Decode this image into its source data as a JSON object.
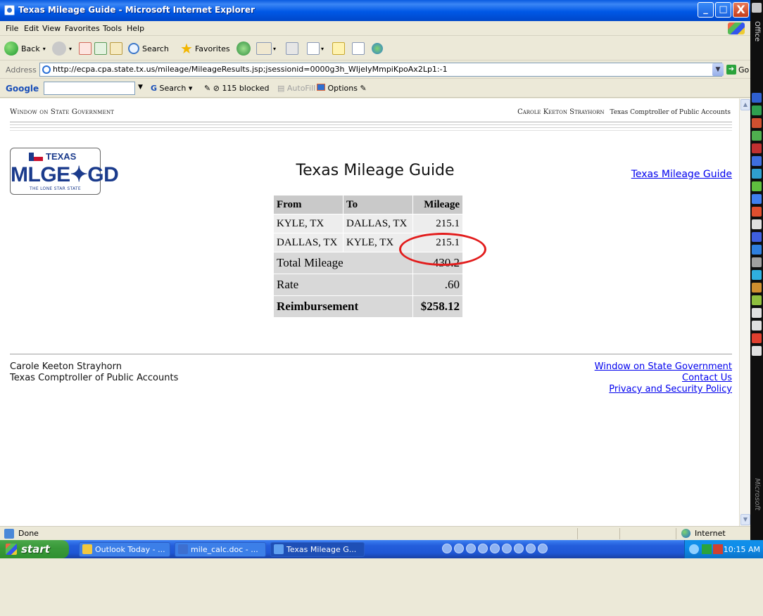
{
  "window": {
    "title": "Texas Mileage Guide - Microsoft Internet Explorer",
    "min": "_",
    "max": "□",
    "close": "X"
  },
  "menu": [
    "File",
    "Edit",
    "View",
    "Favorites",
    "Tools",
    "Help"
  ],
  "toolbar": {
    "back": "Back",
    "search": "Search",
    "favorites": "Favorites"
  },
  "address": {
    "label": "Address",
    "url": "http://ecpa.cpa.state.tx.us/mileage/MileageResults.jsp;jsessionid=0000g3h_WIjeIyMmpiKpoAx2Lp1:-1",
    "go": "Go"
  },
  "googlebar": {
    "logo": "Google",
    "search": "Search",
    "blocked": "115 blocked",
    "autofill": "AutoFill",
    "options": "Options"
  },
  "page": {
    "header_left": "Window on State Government",
    "header_right_name": "Carole Keeton Strayhorn",
    "header_right_title": "Texas Comptroller of Public Accounts",
    "plate": {
      "state": "TEXAS",
      "text": "MLGE✦GD",
      "slogan": "THE LONE STAR STATE"
    },
    "top_link": "Texas Mileage Guide",
    "title": "Texas Mileage Guide",
    "table": {
      "headers": [
        "From",
        "To",
        "Mileage"
      ],
      "rows": [
        [
          "KYLE, TX",
          "DALLAS, TX",
          "215.1"
        ],
        [
          "DALLAS, TX",
          "KYLE, TX",
          "215.1"
        ]
      ],
      "total_label": "Total Mileage",
      "total_value": "430.2",
      "rate_label": "Rate",
      "rate_value": ".60",
      "reimb_label": "Reimbursement",
      "reimb_value": "$258.12"
    },
    "footer_left": [
      "Carole Keeton Strayhorn",
      "Texas Comptroller of Public Accounts"
    ],
    "footer_links": [
      "Window on State Government",
      "Contact Us",
      "Privacy and Security Policy"
    ]
  },
  "status": {
    "text": "Done",
    "zone": "Internet"
  },
  "taskbar": {
    "start": "start",
    "tasks": [
      "Outlook Today - ...",
      "mile_calc.doc - ...",
      "Texas Mileage G..."
    ],
    "clock": "10:15 AM"
  },
  "officebar": {
    "label": "Office",
    "label2": "Microsoft"
  },
  "colors": {
    "highlight": "#e21c1c",
    "link": "#0000ee",
    "title_bar": "#0058e6"
  }
}
